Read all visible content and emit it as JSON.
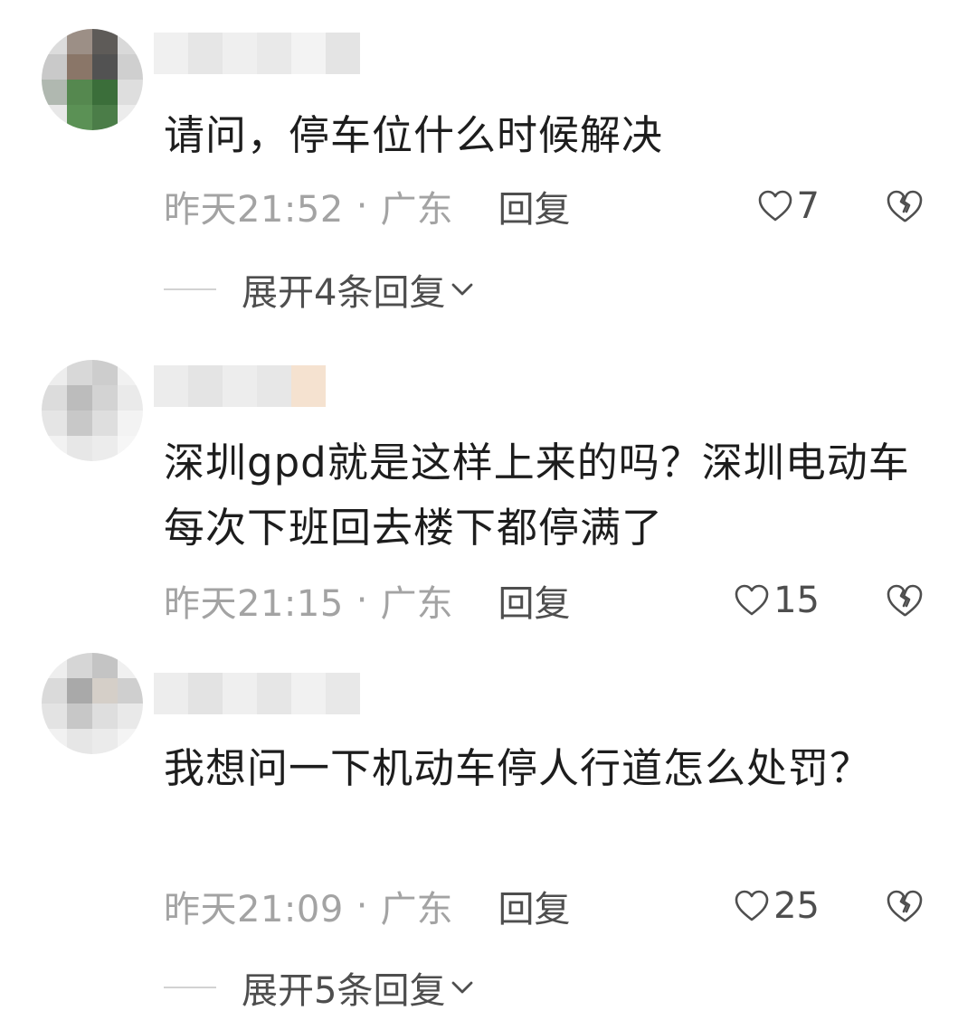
{
  "comments": [
    {
      "text": "请问，停车位什么时候解决",
      "time": "昨天21:52",
      "separator": "·",
      "location": "广东",
      "reply_label": "回复",
      "likes": "7",
      "expand_label": "展开4条回复"
    },
    {
      "text": "深圳gpd就是这样上来的吗？深圳电动车每次下班回去楼下都停满了",
      "time": "昨天21:15",
      "separator": "·",
      "location": "广东",
      "reply_label": "回复",
      "likes": "15"
    },
    {
      "text": "我想问一下机动车停人行道怎么处罚？",
      "time": "昨天21:09",
      "separator": "·",
      "location": "广东",
      "reply_label": "回复",
      "likes": "25",
      "expand_label": "展开5条回复"
    }
  ],
  "icons": {
    "like": "heart-outline-icon",
    "dislike": "broken-heart-icon",
    "expand": "chevron-down-icon"
  },
  "colors": {
    "text": "#1d1d1d",
    "meta": "#a3a3a3",
    "action": "#4e4e4e"
  }
}
